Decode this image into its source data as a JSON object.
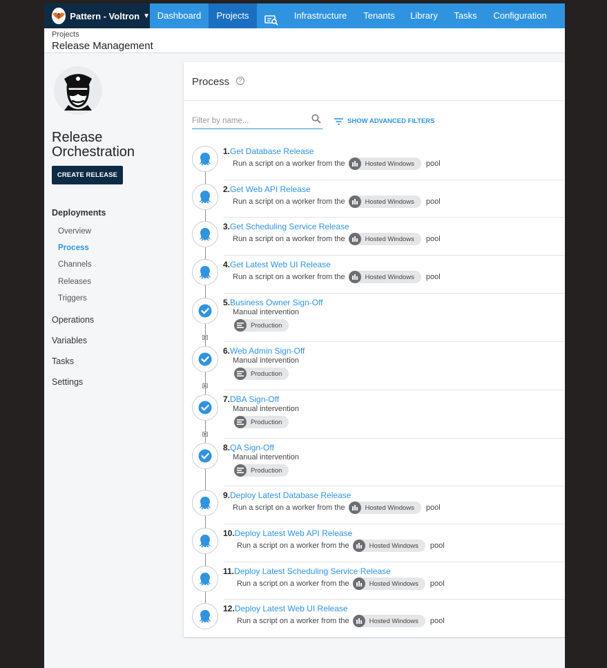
{
  "space": {
    "name": "Pattern - Voltron"
  },
  "nav": {
    "items": [
      {
        "label": "Dashboard"
      },
      {
        "label": "Projects"
      },
      {
        "label": "Infrastructure"
      },
      {
        "label": "Tenants"
      },
      {
        "label": "Library"
      },
      {
        "label": "Tasks"
      },
      {
        "label": "Configuration"
      }
    ],
    "active": "Projects"
  },
  "breadcrumb": {
    "parent": "Projects",
    "title": "Release Management"
  },
  "sidebar": {
    "project_name": "Release Orchestration",
    "create_release": "CREATE RELEASE",
    "sections": [
      {
        "label": "Deployments"
      },
      {
        "label": "Operations"
      },
      {
        "label": "Variables"
      },
      {
        "label": "Tasks"
      },
      {
        "label": "Settings"
      }
    ],
    "deployments_items": [
      {
        "label": "Overview"
      },
      {
        "label": "Process"
      },
      {
        "label": "Channels"
      },
      {
        "label": "Releases"
      },
      {
        "label": "Triggers"
      }
    ],
    "active_item": "Process"
  },
  "process": {
    "title": "Process",
    "filter_placeholder": "Filter by name...",
    "advanced_filters": "SHOW ADVANCED FILTERS",
    "steps": [
      {
        "num": "1.",
        "name": "Get Database Release",
        "type": "script",
        "desc_prefix": "Run a script on a worker from the",
        "pool": "Hosted Windows",
        "desc_suffix": "pool"
      },
      {
        "num": "2.",
        "name": "Get Web API Release",
        "type": "script",
        "desc_prefix": "Run a script on a worker from the",
        "pool": "Hosted Windows",
        "desc_suffix": "pool"
      },
      {
        "num": "3.",
        "name": "Get Scheduling Service Release",
        "type": "script",
        "desc_prefix": "Run a script on a worker from the",
        "pool": "Hosted Windows",
        "desc_suffix": "pool"
      },
      {
        "num": "4.",
        "name": "Get Latest Web UI Release",
        "type": "script",
        "desc_prefix": "Run a script on a worker from the",
        "pool": "Hosted Windows",
        "desc_suffix": "pool"
      },
      {
        "num": "5.",
        "name": "Business Owner Sign-Off",
        "type": "manual",
        "desc": "Manual intervention",
        "env": "Production"
      },
      {
        "num": "6.",
        "name": "Web Admin Sign-Off",
        "type": "manual",
        "desc": "Manual intervention",
        "env": "Production"
      },
      {
        "num": "7.",
        "name": "DBA Sign-Off",
        "type": "manual",
        "desc": "Manual intervention",
        "env": "Production"
      },
      {
        "num": "8.",
        "name": "QA Sign-Off",
        "type": "manual",
        "desc": "Manual intervention",
        "env": "Production"
      },
      {
        "num": "9.",
        "name": "Deploy Latest Database Release",
        "type": "script",
        "desc_prefix": "Run a script on a worker from the",
        "pool": "Hosted Windows",
        "desc_suffix": "pool"
      },
      {
        "num": "10.",
        "name": "Deploy Latest Web API Release",
        "type": "script",
        "desc_prefix": "Run a script on a worker from the",
        "pool": "Hosted Windows",
        "desc_suffix": "pool"
      },
      {
        "num": "11.",
        "name": "Deploy Latest Scheduling Service Release",
        "type": "script",
        "desc_prefix": "Run a script on a worker from the",
        "pool": "Hosted Windows",
        "desc_suffix": "pool"
      },
      {
        "num": "12.",
        "name": "Deploy Latest Web UI Release",
        "type": "script",
        "desc_prefix": "Run a script on a worker from the",
        "pool": "Hosted Windows",
        "desc_suffix": "pool"
      }
    ]
  },
  "colors": {
    "nav_blue": "#2f93e0",
    "nav_active": "#1a6fc0",
    "navy": "#0e2b46",
    "link": "#2f93e0"
  },
  "icons": {
    "space_logo": "voltron-logo-icon",
    "project_logo": "police-officer-icon",
    "script_step": "octopus-icon",
    "manual_step": "check-circle-icon",
    "worker_pool": "worker-pool-icon",
    "environment": "environment-icon",
    "search": "search-icon",
    "filter": "filter-icon",
    "help": "help-icon"
  }
}
